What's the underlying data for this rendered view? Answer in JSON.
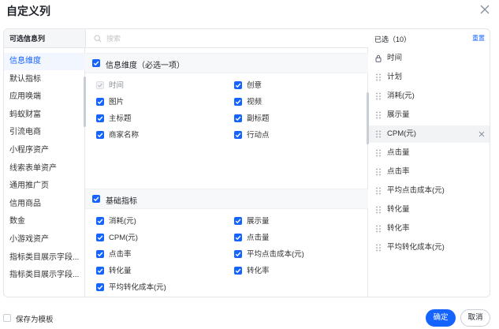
{
  "dialog": {
    "title": "自定义列"
  },
  "left_panel": {
    "header": "可选信息列"
  },
  "search": {
    "placeholder": "搜索"
  },
  "categories": [
    {
      "label": "信息维度",
      "active": true
    },
    {
      "label": "默认指标",
      "active": false
    },
    {
      "label": "应用唤端",
      "active": false
    },
    {
      "label": "蚂蚁财富",
      "active": false
    },
    {
      "label": "引流电商",
      "active": false
    },
    {
      "label": "小程序资产",
      "active": false
    },
    {
      "label": "线索表单资产",
      "active": false
    },
    {
      "label": "通用推广页",
      "active": false
    },
    {
      "label": "信用商品",
      "active": false
    },
    {
      "label": "数金",
      "active": false
    },
    {
      "label": "小游戏资产",
      "active": false
    },
    {
      "label": "指标类目展示字段...",
      "active": false
    },
    {
      "label": "指标类目展示字段...",
      "active": false
    }
  ],
  "sections": [
    {
      "title": "信息维度（必选一项）",
      "checked": true,
      "options": [
        {
          "label": "时间",
          "checked": true,
          "disabled": true
        },
        {
          "label": "创意",
          "checked": true,
          "disabled": false
        },
        {
          "label": "图片",
          "checked": true,
          "disabled": false
        },
        {
          "label": "视频",
          "checked": true,
          "disabled": false
        },
        {
          "label": "主标题",
          "checked": true,
          "disabled": false
        },
        {
          "label": "副标题",
          "checked": true,
          "disabled": false
        },
        {
          "label": "商家名称",
          "checked": true,
          "disabled": false
        },
        {
          "label": "行动点",
          "checked": true,
          "disabled": false
        }
      ]
    },
    {
      "title": "基础指标",
      "checked": true,
      "options": [
        {
          "label": "消耗(元)",
          "checked": true,
          "disabled": false
        },
        {
          "label": "展示量",
          "checked": true,
          "disabled": false
        },
        {
          "label": "CPM(元)",
          "checked": true,
          "disabled": false
        },
        {
          "label": "点击量",
          "checked": true,
          "disabled": false
        },
        {
          "label": "点击率",
          "checked": true,
          "disabled": false
        },
        {
          "label": "平均点击成本(元)",
          "checked": true,
          "disabled": false
        },
        {
          "label": "转化量",
          "checked": true,
          "disabled": false
        },
        {
          "label": "转化率",
          "checked": true,
          "disabled": false
        },
        {
          "label": "平均转化成本(元)",
          "checked": true,
          "disabled": false
        }
      ]
    }
  ],
  "selected": {
    "header": "已选（10）",
    "clear_label": "重置",
    "items": [
      {
        "label": "时间",
        "locked": true
      },
      {
        "label": "计划",
        "locked": false
      },
      {
        "label": "消耗(元)",
        "locked": false
      },
      {
        "label": "展示量",
        "locked": false
      },
      {
        "label": "CPM(元)",
        "locked": false,
        "hover": true
      },
      {
        "label": "点击量",
        "locked": false
      },
      {
        "label": "点击率",
        "locked": false
      },
      {
        "label": "平均点击成本(元)",
        "locked": false
      },
      {
        "label": "转化量",
        "locked": false
      },
      {
        "label": "转化率",
        "locked": false
      },
      {
        "label": "平均转化成本(元)",
        "locked": false
      }
    ]
  },
  "footer": {
    "save_template_label": "保存为模板",
    "save_template_checked": false,
    "ok_label": "确定",
    "cancel_label": "取消"
  },
  "colors": {
    "accent": "#1664ff",
    "border": "#e5e6eb",
    "active_bg": "#f2f6ff"
  }
}
